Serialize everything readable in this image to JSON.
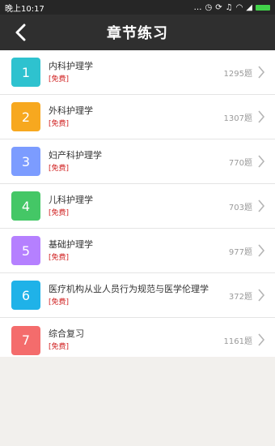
{
  "status_bar": {
    "time": "晚上10:17",
    "icons": [
      "dots-icon",
      "alarm-icon",
      "sync-icon",
      "headset-icon",
      "wifi-icon",
      "signal-icon",
      "battery-icon"
    ]
  },
  "header": {
    "title": "章节练习",
    "back_icon": "chevron-left-icon"
  },
  "colors": {
    "status_bar_bg": "#262626",
    "nav_bg": "#2f2f2f",
    "badge_colors": [
      "#2ec2cf",
      "#f7a81f",
      "#7c9cff",
      "#44c766",
      "#b580ff",
      "#1fb2e8",
      "#f46c6c"
    ],
    "tag_color": "#d02020"
  },
  "chapters": [
    {
      "index": "1",
      "title": "内科护理学",
      "tag": "[免费]",
      "count": "1295题"
    },
    {
      "index": "2",
      "title": "外科护理学",
      "tag": "[免费]",
      "count": "1307题"
    },
    {
      "index": "3",
      "title": "妇产科护理学",
      "tag": "[免费]",
      "count": "770题"
    },
    {
      "index": "4",
      "title": "儿科护理学",
      "tag": "[免费]",
      "count": "703题"
    },
    {
      "index": "5",
      "title": "基础护理学",
      "tag": "[免费]",
      "count": "977题"
    },
    {
      "index": "6",
      "title": "医疗机构从业人员行为规范与医学伦理学",
      "tag": "[免费]",
      "count": "372题"
    },
    {
      "index": "7",
      "title": "综合复习",
      "tag": "[免费]",
      "count": "1161题"
    }
  ]
}
